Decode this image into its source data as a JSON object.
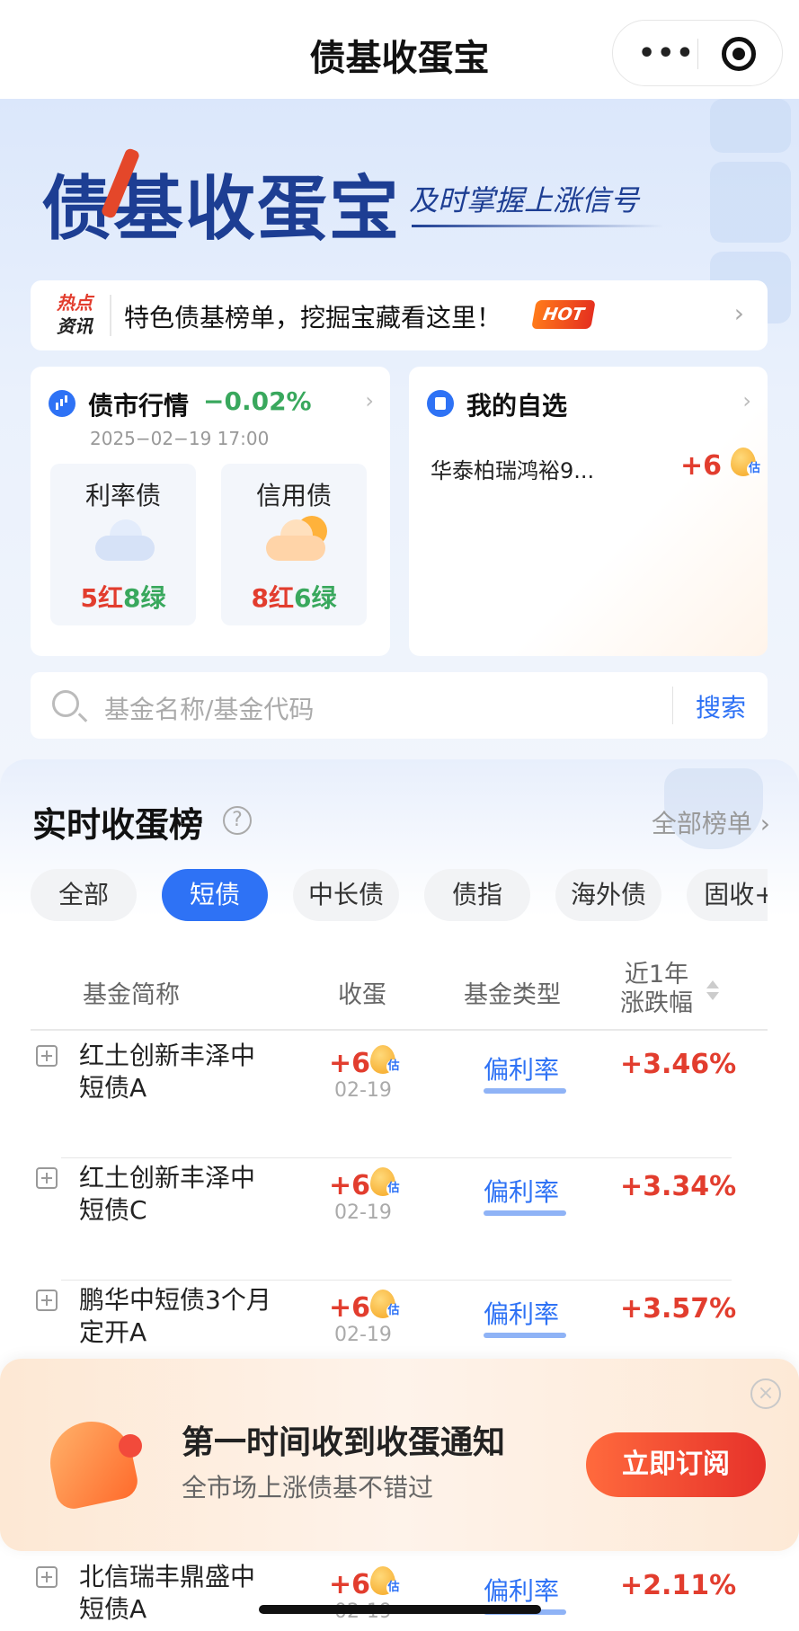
{
  "nav": {
    "title": "债基收蛋宝",
    "more_label": "•••"
  },
  "hero": {
    "logo_text": "债基收蛋宝",
    "slogan": "及时掌握上涨信号"
  },
  "news": {
    "tag_line1": "热点",
    "tag_line2": "资讯",
    "text": "特色债基榜单，挖掘宝藏看这里！",
    "hot_badge": "HOT",
    "chevron": "›"
  },
  "market": {
    "label": "债市行情",
    "change": "−0.02%",
    "time": "2025−02−19 17:00",
    "chevron": "›",
    "rate_bond": {
      "name": "利率债",
      "red": "5红",
      "green": "8绿",
      "weather": "cloudy-icon"
    },
    "credit_bond": {
      "name": "信用债",
      "red": "8红",
      "green": "6绿",
      "weather": "partly-sunny-icon"
    }
  },
  "watchlist": {
    "label": "我的自选",
    "chevron": "›",
    "fund_name": "华泰柏瑞鸿裕9...",
    "value": "+6",
    "est": "估"
  },
  "search": {
    "placeholder": "基金名称/基金代码",
    "button": "搜索"
  },
  "ranking": {
    "title": "实时收蛋榜",
    "help": "?",
    "all_label": "全部榜单 ›",
    "tabs": [
      "全部",
      "短债",
      "中长债",
      "债指",
      "海外债",
      "固收+"
    ],
    "active_tab": "短债",
    "headers": {
      "name": "基金简称",
      "egg": "收蛋",
      "type": "基金类型",
      "return_line1": "近1年",
      "return_line2": "涨跌幅"
    },
    "rows": [
      {
        "name": "红土创新丰泽中短债A",
        "egg": "+6",
        "est": "估",
        "date": "02-19",
        "type": "偏利率",
        "return": "+3.46%"
      },
      {
        "name": "红土创新丰泽中短债C",
        "egg": "+6",
        "est": "估",
        "date": "02-19",
        "type": "偏利率",
        "return": "+3.34%"
      },
      {
        "name": "鹏华中短债3个月定开A",
        "egg": "+6",
        "est": "估",
        "date": "02-19",
        "type": "偏利率",
        "return": "+3.57%"
      },
      {
        "name": "北信瑞丰鼎盛中短债A",
        "egg": "+6",
        "est": "估",
        "date": "02-19",
        "type": "偏利率",
        "return": "+2.11%"
      }
    ]
  },
  "banner": {
    "title": "第一时间收到收蛋通知",
    "subtitle": "全市场上涨债基不错过",
    "button": "立即订阅",
    "close": "×"
  },
  "colors": {
    "accent": "#2e72f5",
    "red": "#e23d2e",
    "green": "#39a85d",
    "brand_navy": "#1d3e93"
  }
}
